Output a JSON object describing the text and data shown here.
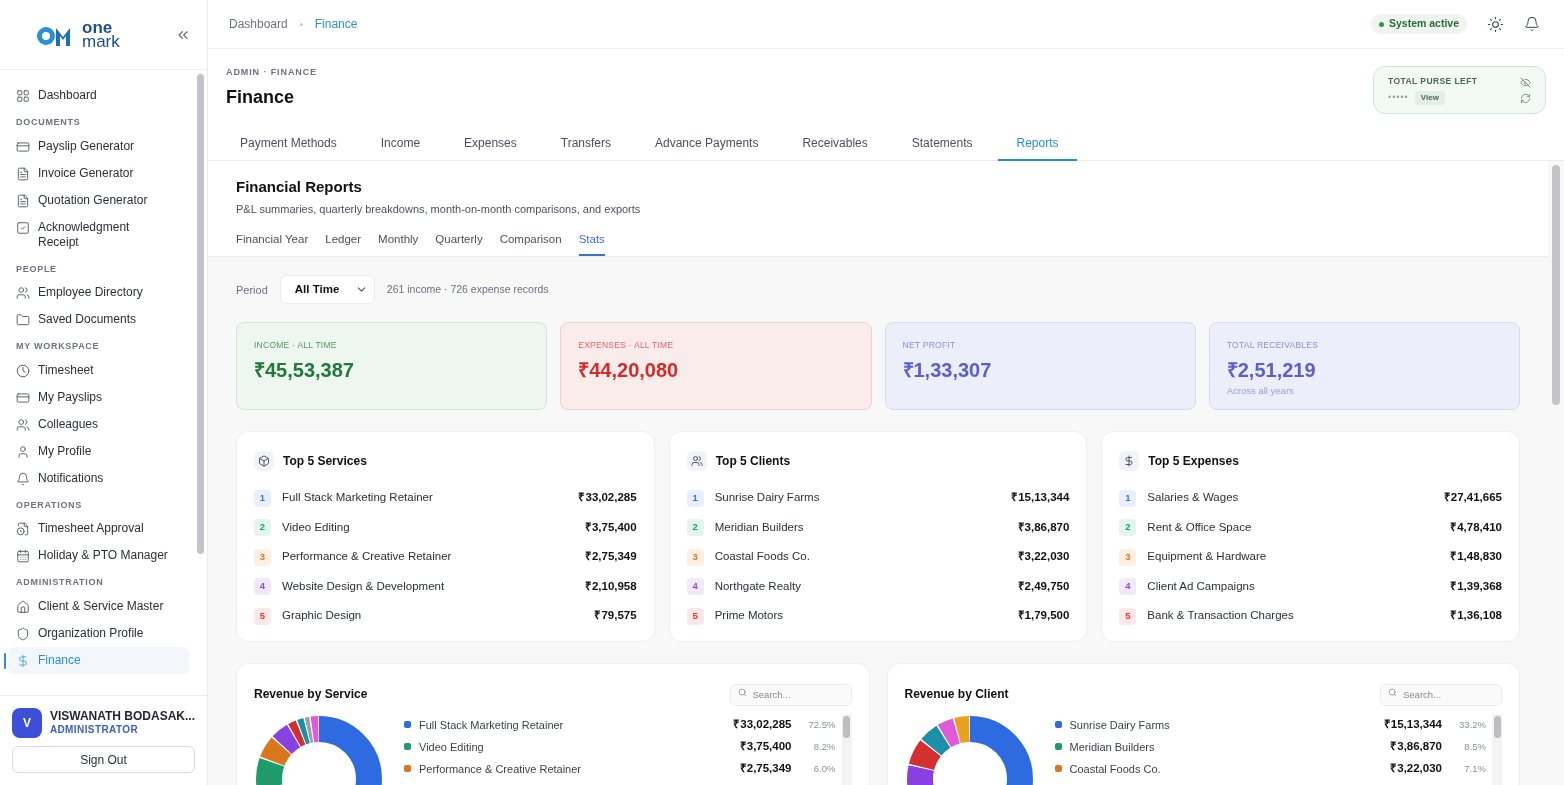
{
  "brand": {
    "line1": "one",
    "line2": "mark"
  },
  "sidebar": {
    "sections": [
      {
        "items": [
          {
            "label": "Dashboard",
            "selected": false
          }
        ]
      },
      {
        "title": "DOCUMENTS",
        "items": [
          {
            "label": "Payslip Generator",
            "selected": false
          },
          {
            "label": "Invoice Generator",
            "selected": false
          },
          {
            "label": "Quotation Generator",
            "selected": false
          },
          {
            "label": "Acknowledgment Receipt",
            "selected": false
          }
        ]
      },
      {
        "title": "PEOPLE",
        "items": [
          {
            "label": "Employee Directory",
            "selected": false
          },
          {
            "label": "Saved Documents",
            "selected": false
          }
        ]
      },
      {
        "title": "MY WORKSPACE",
        "items": [
          {
            "label": "Timesheet",
            "selected": false
          },
          {
            "label": "My Payslips",
            "selected": false
          },
          {
            "label": "Colleagues",
            "selected": false
          },
          {
            "label": "My Profile",
            "selected": false
          },
          {
            "label": "Notifications",
            "selected": false
          }
        ]
      },
      {
        "title": "OPERATIONS",
        "items": [
          {
            "label": "Timesheet Approval",
            "selected": false
          },
          {
            "label": "Holiday & PTO Manager",
            "selected": false
          }
        ]
      },
      {
        "title": "ADMINISTRATION",
        "items": [
          {
            "label": "Client & Service Master",
            "selected": false
          },
          {
            "label": "Organization Profile",
            "selected": false
          },
          {
            "label": "Finance",
            "selected": true
          }
        ]
      }
    ],
    "user": {
      "initial": "V",
      "name": "VISWANATH BODASAK...",
      "role": "ADMINISTRATOR"
    },
    "sign_out": "Sign Out"
  },
  "breadcrumbs": [
    {
      "label": "Dashboard",
      "selected": false
    },
    {
      "label": "Finance",
      "selected": true
    }
  ],
  "status": {
    "label": "System active",
    "on": true
  },
  "header": {
    "eyebrow": "ADMIN · FINANCE",
    "title": "Finance"
  },
  "purse": {
    "title": "TOTAL PURSE LEFT",
    "masked_value": "•••••",
    "view": "View"
  },
  "tabs": [
    {
      "label": "Payment Methods",
      "selected": false
    },
    {
      "label": "Income",
      "selected": false
    },
    {
      "label": "Expenses",
      "selected": false
    },
    {
      "label": "Transfers",
      "selected": false
    },
    {
      "label": "Advance Payments",
      "selected": false
    },
    {
      "label": "Receivables",
      "selected": false
    },
    {
      "label": "Statements",
      "selected": false
    },
    {
      "label": "Reports",
      "selected": true
    }
  ],
  "reports": {
    "title": "Financial Reports",
    "subtitle": "P&L summaries, quarterly breakdowns, month-on-month comparisons, and exports",
    "subtabs": [
      {
        "label": "Financial Year",
        "selected": false
      },
      {
        "label": "Ledger",
        "selected": false
      },
      {
        "label": "Monthly",
        "selected": false
      },
      {
        "label": "Quarterly",
        "selected": false
      },
      {
        "label": "Comparison",
        "selected": false
      },
      {
        "label": "Stats",
        "selected": true
      }
    ]
  },
  "period": {
    "label": "Period",
    "value": "All Time",
    "records": "261 income · 726 expense records"
  },
  "stat_cards": [
    {
      "kind": "income",
      "label": "INCOME · ALL TIME",
      "value": "₹45,53,387"
    },
    {
      "kind": "expenses",
      "label": "EXPENSES · ALL TIME",
      "value": "₹44,20,080"
    },
    {
      "kind": "profit",
      "label": "NET PROFIT",
      "value": "₹1,33,307"
    },
    {
      "kind": "receivables",
      "label": "TOTAL RECEIVABLES",
      "value": "₹2,51,219",
      "note": "Across all years"
    }
  ],
  "top_lists": [
    {
      "kind": "services",
      "title": "Top 5 Services",
      "rows": [
        {
          "rank": "1",
          "name": "Full Stack Marketing Retainer",
          "amount": "₹33,02,285"
        },
        {
          "rank": "2",
          "name": "Video Editing",
          "amount": "₹3,75,400"
        },
        {
          "rank": "3",
          "name": "Performance & Creative Retainer",
          "amount": "₹2,75,349"
        },
        {
          "rank": "4",
          "name": "Website Design & Development",
          "amount": "₹2,10,958"
        },
        {
          "rank": "5",
          "name": "Graphic Design",
          "amount": "₹79,575"
        }
      ]
    },
    {
      "kind": "clients",
      "title": "Top 5 Clients",
      "rows": [
        {
          "rank": "1",
          "name": "Sunrise Dairy Farms",
          "amount": "₹15,13,344"
        },
        {
          "rank": "2",
          "name": "Meridian Builders",
          "amount": "₹3,86,870"
        },
        {
          "rank": "3",
          "name": "Coastal Foods Co.",
          "amount": "₹3,22,030"
        },
        {
          "rank": "4",
          "name": "Northgate Realty",
          "amount": "₹2,49,750"
        },
        {
          "rank": "5",
          "name": "Prime Motors",
          "amount": "₹1,79,500"
        }
      ]
    },
    {
      "kind": "expenses",
      "title": "Top 5 Expenses",
      "rows": [
        {
          "rank": "1",
          "name": "Salaries & Wages",
          "amount": "₹27,41,665"
        },
        {
          "rank": "2",
          "name": "Rent & Office Space",
          "amount": "₹4,78,410"
        },
        {
          "rank": "3",
          "name": "Equipment & Hardware",
          "amount": "₹1,48,830"
        },
        {
          "rank": "4",
          "name": "Client Ad Campaigns",
          "amount": "₹1,39,368"
        },
        {
          "rank": "5",
          "name": "Bank & Transaction Charges",
          "amount": "₹1,36,108"
        }
      ]
    }
  ],
  "revenue_cards": [
    {
      "kind": "service",
      "title": "Revenue by Service",
      "search_placeholder": "Search...",
      "legend": [
        {
          "name": "Full Stack Marketing Retainer",
          "amount": "₹33,02,285",
          "share": "72.5%",
          "color": "#2f6be0"
        },
        {
          "name": "Video Editing",
          "amount": "₹3,75,400",
          "share": "8.2%",
          "color": "#1f9a6a"
        },
        {
          "name": "Performance & Creative Retainer",
          "amount": "₹2,75,349",
          "share": "6.0%",
          "color": "#d9771c"
        }
      ]
    },
    {
      "kind": "client",
      "title": "Revenue by Client",
      "search_placeholder": "Search...",
      "legend": [
        {
          "name": "Sunrise Dairy Farms",
          "amount": "₹15,13,344",
          "share": "33.2%",
          "color": "#2f6be0"
        },
        {
          "name": "Meridian Builders",
          "amount": "₹3,86,870",
          "share": "8.5%",
          "color": "#1f9a6a"
        },
        {
          "name": "Coastal Foods Co.",
          "amount": "₹3,22,030",
          "share": "7.1%",
          "color": "#d9771c"
        }
      ]
    }
  ]
}
